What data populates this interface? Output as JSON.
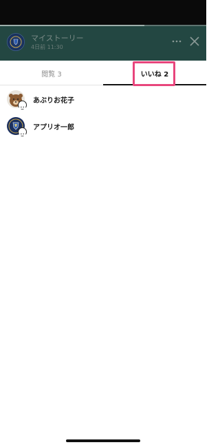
{
  "story": {
    "title": "マイストーリー",
    "time": "4日前 11:30",
    "progress": 0.7,
    "more_icon": "more-icon",
    "close_icon": "close-icon"
  },
  "tabs": {
    "views_label": "閲覧 3",
    "likes_label": "いいね 2",
    "active": "likes"
  },
  "likes_list": [
    {
      "name": "あぶりお花子",
      "avatar_icon": "bear-avatar-icon",
      "badge_icon": "reaction-badge-icon"
    },
    {
      "name": "アプリオ一郎",
      "avatar_icon": "crest-avatar-icon",
      "badge_icon": "reaction-badge-icon"
    }
  ],
  "colors": {
    "header_bg": "#234742",
    "status_bar": "#0a0a0a",
    "highlight": "#e8457c",
    "active_tab_underline": "#111111"
  }
}
